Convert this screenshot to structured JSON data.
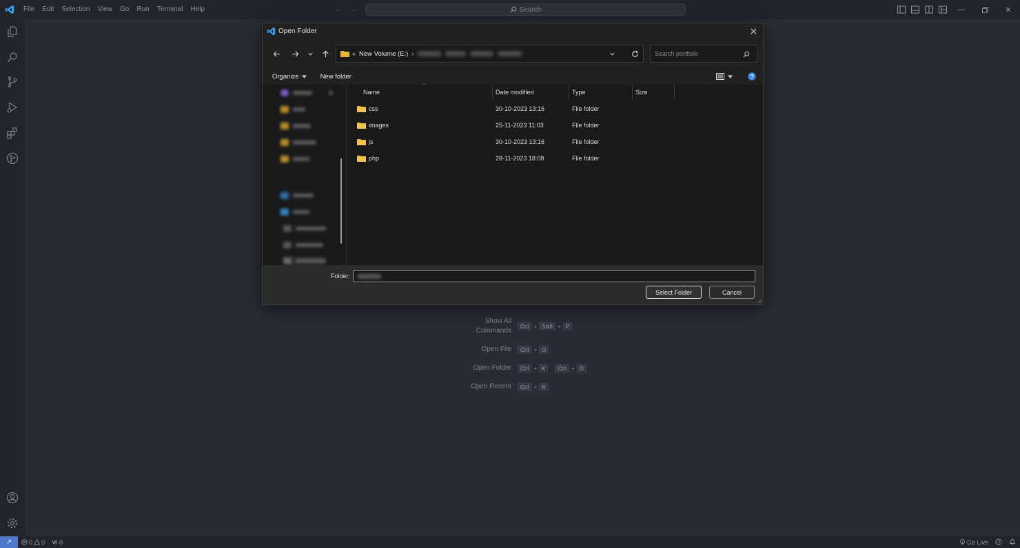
{
  "titlebar": {
    "menu": [
      "File",
      "Edit",
      "Selection",
      "View",
      "Go",
      "Run",
      "Terminal",
      "Help"
    ],
    "search_placeholder": "Search"
  },
  "welcome": {
    "shortcuts": [
      {
        "label_line1": "Show All",
        "label_line2": "Commands",
        "keys": [
          [
            "Ctrl",
            "Shift",
            "P"
          ]
        ]
      },
      {
        "label_line1": "Open File",
        "label_line2": "",
        "keys": [
          [
            "Ctrl",
            "O"
          ]
        ]
      },
      {
        "label_line1": "Open Folder",
        "label_line2": "",
        "keys": [
          [
            "Ctrl",
            "K"
          ],
          [
            "Ctrl",
            "O"
          ]
        ]
      },
      {
        "label_line1": "Open Recent",
        "label_line2": "",
        "keys": [
          [
            "Ctrl",
            "R"
          ]
        ]
      }
    ]
  },
  "statusbar": {
    "errors": "0",
    "warnings": "0",
    "ports": "0",
    "go_live": "Go Live"
  },
  "dialog": {
    "title": "Open Folder",
    "address_root": "New Volume (E:)",
    "search_placeholder": "Search portfolio",
    "organize": "Organize",
    "new_folder": "New folder",
    "columns": {
      "name": "Name",
      "date": "Date modified",
      "type": "Type",
      "size": "Size"
    },
    "files": [
      {
        "name": "css",
        "date": "30-10-2023 13:16",
        "type": "File folder"
      },
      {
        "name": "images",
        "date": "25-11-2023 11:03",
        "type": "File folder"
      },
      {
        "name": "js",
        "date": "30-10-2023 13:16",
        "type": "File folder"
      },
      {
        "name": "php",
        "date": "28-11-2023 18:08",
        "type": "File folder"
      }
    ],
    "folder_label": "Folder:",
    "select_button": "Select Folder",
    "cancel_button": "Cancel"
  },
  "colors": {
    "editor_bg": "#282c34",
    "chrome_bg": "#21252b",
    "dialog_bg": "#191919",
    "folder_yellow": "#e8b53a",
    "vscode_blue": "#3ea0f3",
    "remote_blue": "#4d78cc"
  }
}
